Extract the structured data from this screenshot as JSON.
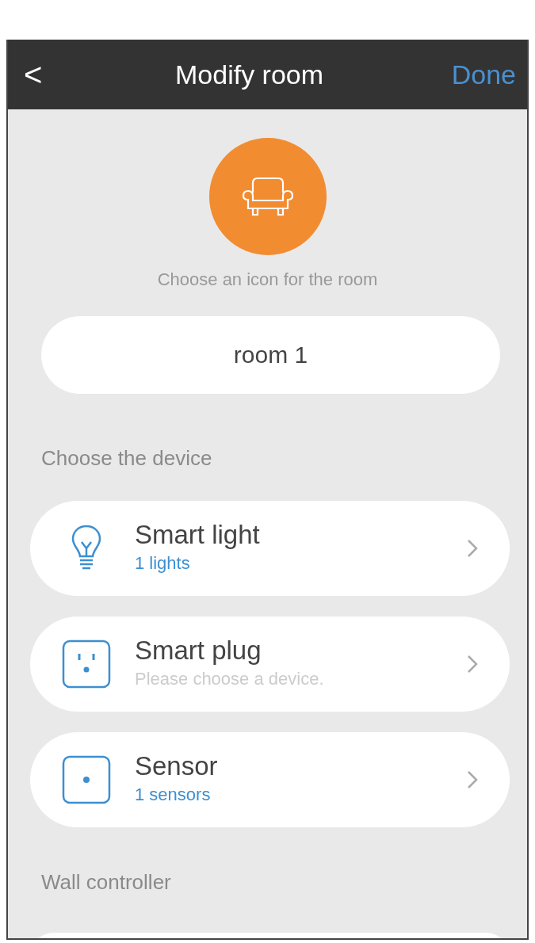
{
  "nav": {
    "back": "<",
    "title": "Modify room",
    "action": "Done"
  },
  "room_icon": {
    "kind": "sofa",
    "caption": "Choose an icon for the room"
  },
  "room_name": {
    "value": "room 1"
  },
  "sections": [
    {
      "heading": "Choose the device",
      "items": [
        {
          "kind": "light",
          "name": "Smart light",
          "status": "1 lights",
          "empty": false
        },
        {
          "kind": "plug",
          "name": "Smart plug",
          "status": "Please choose a device.",
          "empty": true
        },
        {
          "kind": "sensor",
          "name": "Sensor",
          "status": "1 sensors",
          "empty": false
        }
      ]
    },
    {
      "heading": "Wall controller"
    }
  ]
}
